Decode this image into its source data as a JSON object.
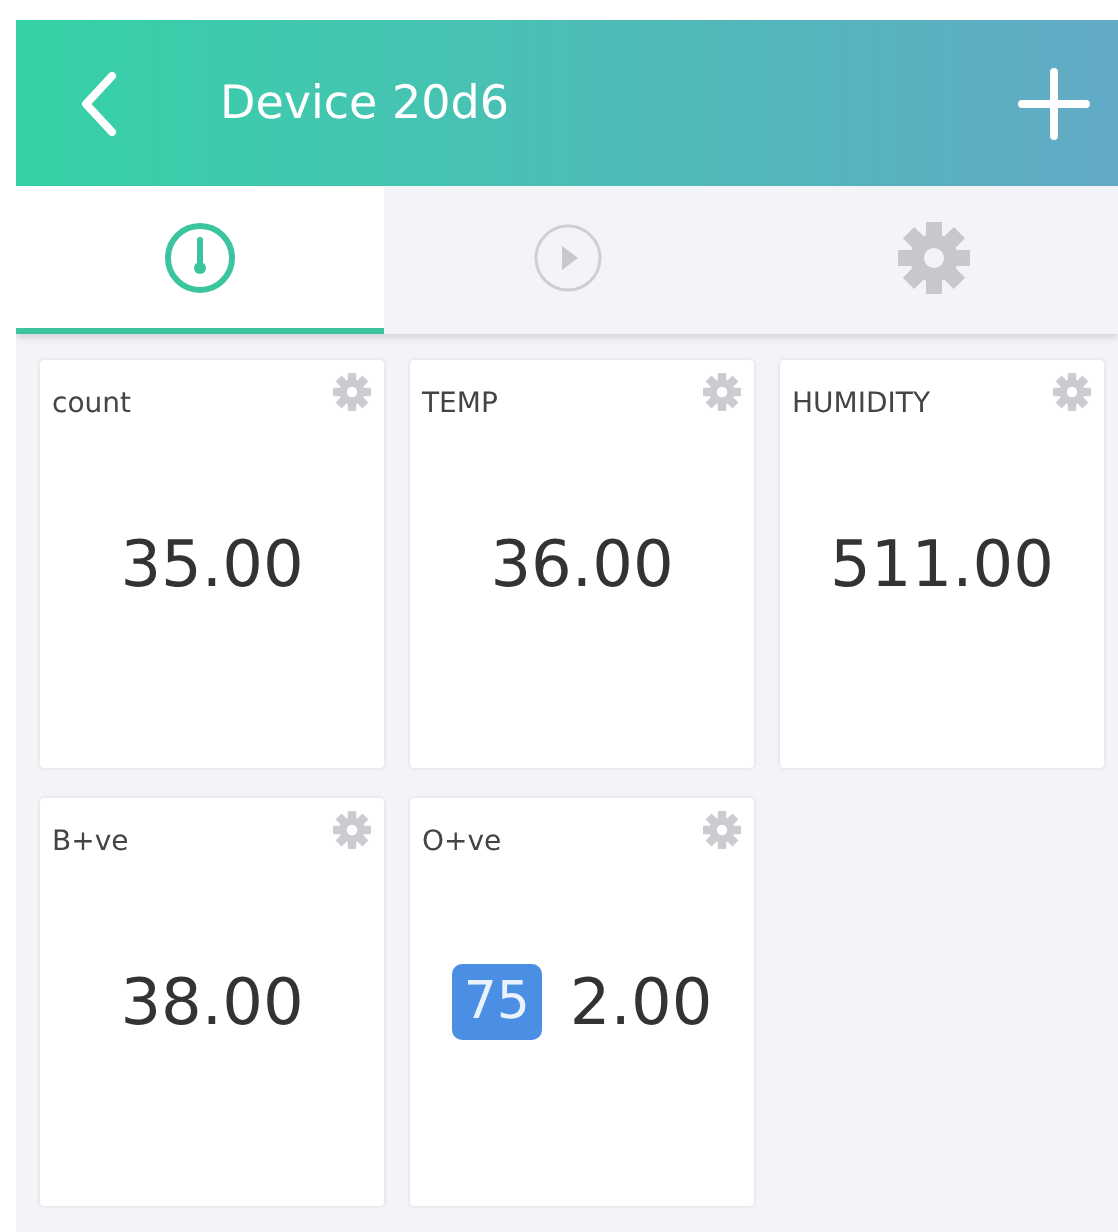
{
  "header": {
    "title": "Device 20d6"
  },
  "tabs": [
    {
      "kind": "gauge",
      "selected": true
    },
    {
      "kind": "play",
      "selected": false
    },
    {
      "kind": "settings",
      "selected": false
    }
  ],
  "widgets": [
    {
      "label": "count",
      "value": "35.00"
    },
    {
      "label": "TEMP",
      "value": "36.00"
    },
    {
      "label": "HUMIDITY",
      "value": "511.00"
    },
    {
      "label": "B+ve",
      "value": "38.00"
    },
    {
      "label": "O+ve",
      "value": "2.00",
      "badge": "75"
    }
  ]
}
